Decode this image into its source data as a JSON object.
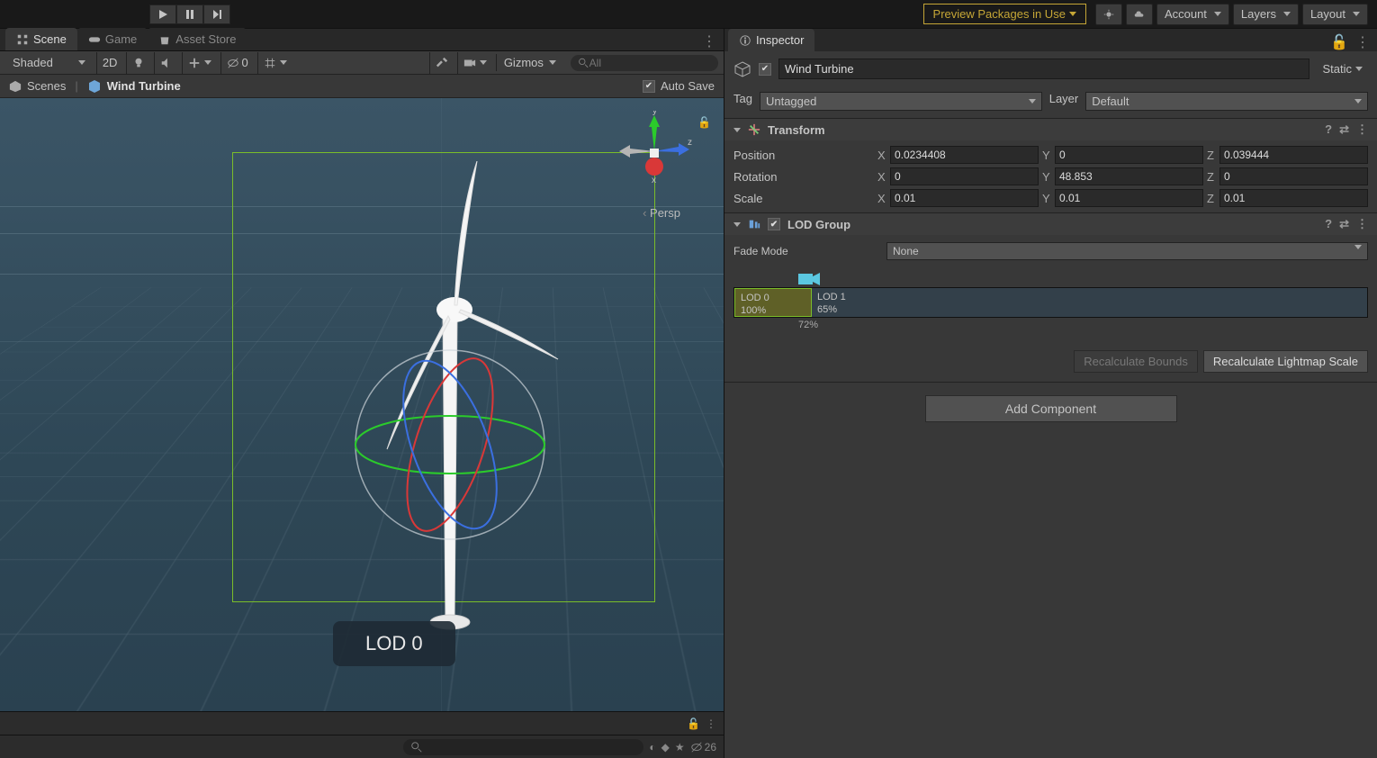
{
  "toolbar": {
    "preview_label": "Preview Packages in Use",
    "account_label": "Account",
    "layers_label": "Layers",
    "layout_label": "Layout"
  },
  "tabs": {
    "scene": "Scene",
    "game": "Game",
    "asset_store": "Asset Store",
    "inspector": "Inspector"
  },
  "scene_toolbar": {
    "shading": "Shaded",
    "toggle2d": "2D",
    "hidden_count": "0",
    "gizmos": "Gizmos",
    "search_placeholder": "All"
  },
  "breadcrumb": {
    "scenes": "Scenes",
    "object": "Wind Turbine",
    "autosave": "Auto Save"
  },
  "scene": {
    "persp": "Persp",
    "axis_x": "x",
    "axis_y": "y",
    "axis_z": "z",
    "lod_badge": "LOD 0"
  },
  "bottom": {
    "hidden": "26"
  },
  "inspector": {
    "name": "Wind Turbine",
    "static": "Static",
    "tag_label": "Tag",
    "tag_value": "Untagged",
    "layer_label": "Layer",
    "layer_value": "Default",
    "transform": {
      "title": "Transform",
      "pos_label": "Position",
      "rot_label": "Rotation",
      "scale_label": "Scale",
      "pos_x": "0.0234408",
      "pos_y": "0",
      "pos_z": "0.039444",
      "rot_x": "0",
      "rot_y": "48.853",
      "rot_z": "0",
      "scale_x": "0.01",
      "scale_y": "0.01",
      "scale_z": "0.01",
      "x": "X",
      "y": "Y",
      "z": "Z"
    },
    "lodgroup": {
      "title": "LOD Group",
      "fade_label": "Fade Mode",
      "fade_value": "None",
      "lod0_name": "LOD 0",
      "lod0_pct": "100%",
      "lod1_name": "LOD 1",
      "lod1_pct": "65%",
      "slider_pct": "72%",
      "recalc_bounds": "Recalculate Bounds",
      "recalc_light": "Recalculate Lightmap Scale"
    },
    "add_component": "Add Component"
  }
}
